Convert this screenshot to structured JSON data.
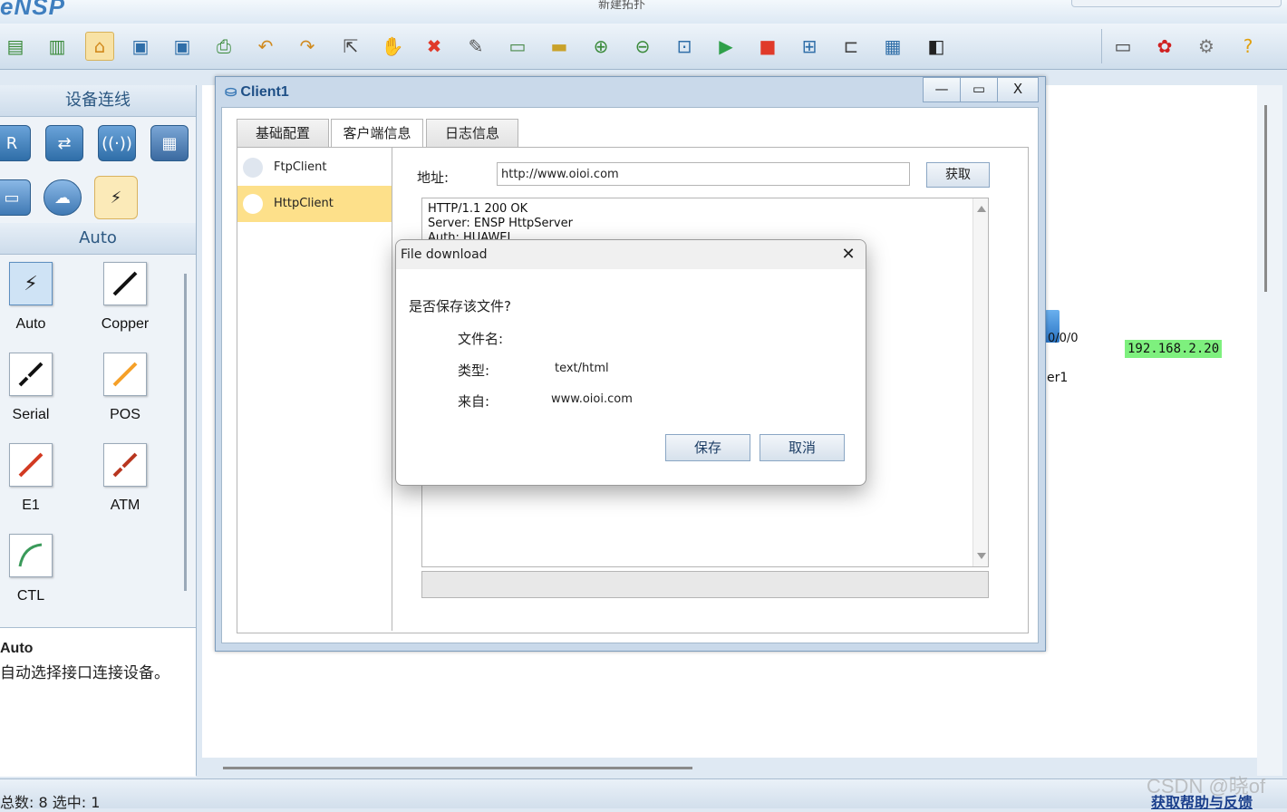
{
  "app": {
    "logo": "eNSP",
    "project_title": "新建拓扑"
  },
  "left_panel": {
    "devices_header": "设备连线",
    "conn_header": "Auto",
    "connections": [
      {
        "label": "Auto"
      },
      {
        "label": "Copper"
      },
      {
        "label": "Serial"
      },
      {
        "label": "POS"
      },
      {
        "label": "E1"
      },
      {
        "label": "ATM"
      },
      {
        "label": "CTL"
      }
    ],
    "description": {
      "title": "Auto",
      "text": "自动选择接口连接设备。"
    }
  },
  "canvas": {
    "ip_label": "192.168.2.20",
    "port_label": "0/0/0",
    "node_label": "er1"
  },
  "statusbar": {
    "count_text": "总数: 8 选中: 1",
    "help_link": "获取帮助与反馈",
    "watermark": "CSDN @晓of"
  },
  "client_window": {
    "title": "Client1",
    "ctrl_minimize": "—",
    "ctrl_maximize": "▭",
    "ctrl_close": "X",
    "tabs": [
      "基础配置",
      "客户端信息",
      "日志信息"
    ],
    "side_items": [
      "FtpClient",
      "HttpClient"
    ],
    "address_label": "地址:",
    "address_value": "http://www.oioi.com",
    "fetch_button": "获取",
    "response_lines": [
      "HTTP/1.1 200 OK",
      "Server: ENSP HttpServer",
      "Auth: HUAWEI"
    ]
  },
  "dialog": {
    "title": "File download",
    "question": "是否保存该文件?",
    "filename_label": "文件名:",
    "type_label": "类型:",
    "type_value": "text/html",
    "from_label": "来自:",
    "from_value": "www.oioi.com",
    "save_button": "保存",
    "cancel_button": "取消"
  }
}
